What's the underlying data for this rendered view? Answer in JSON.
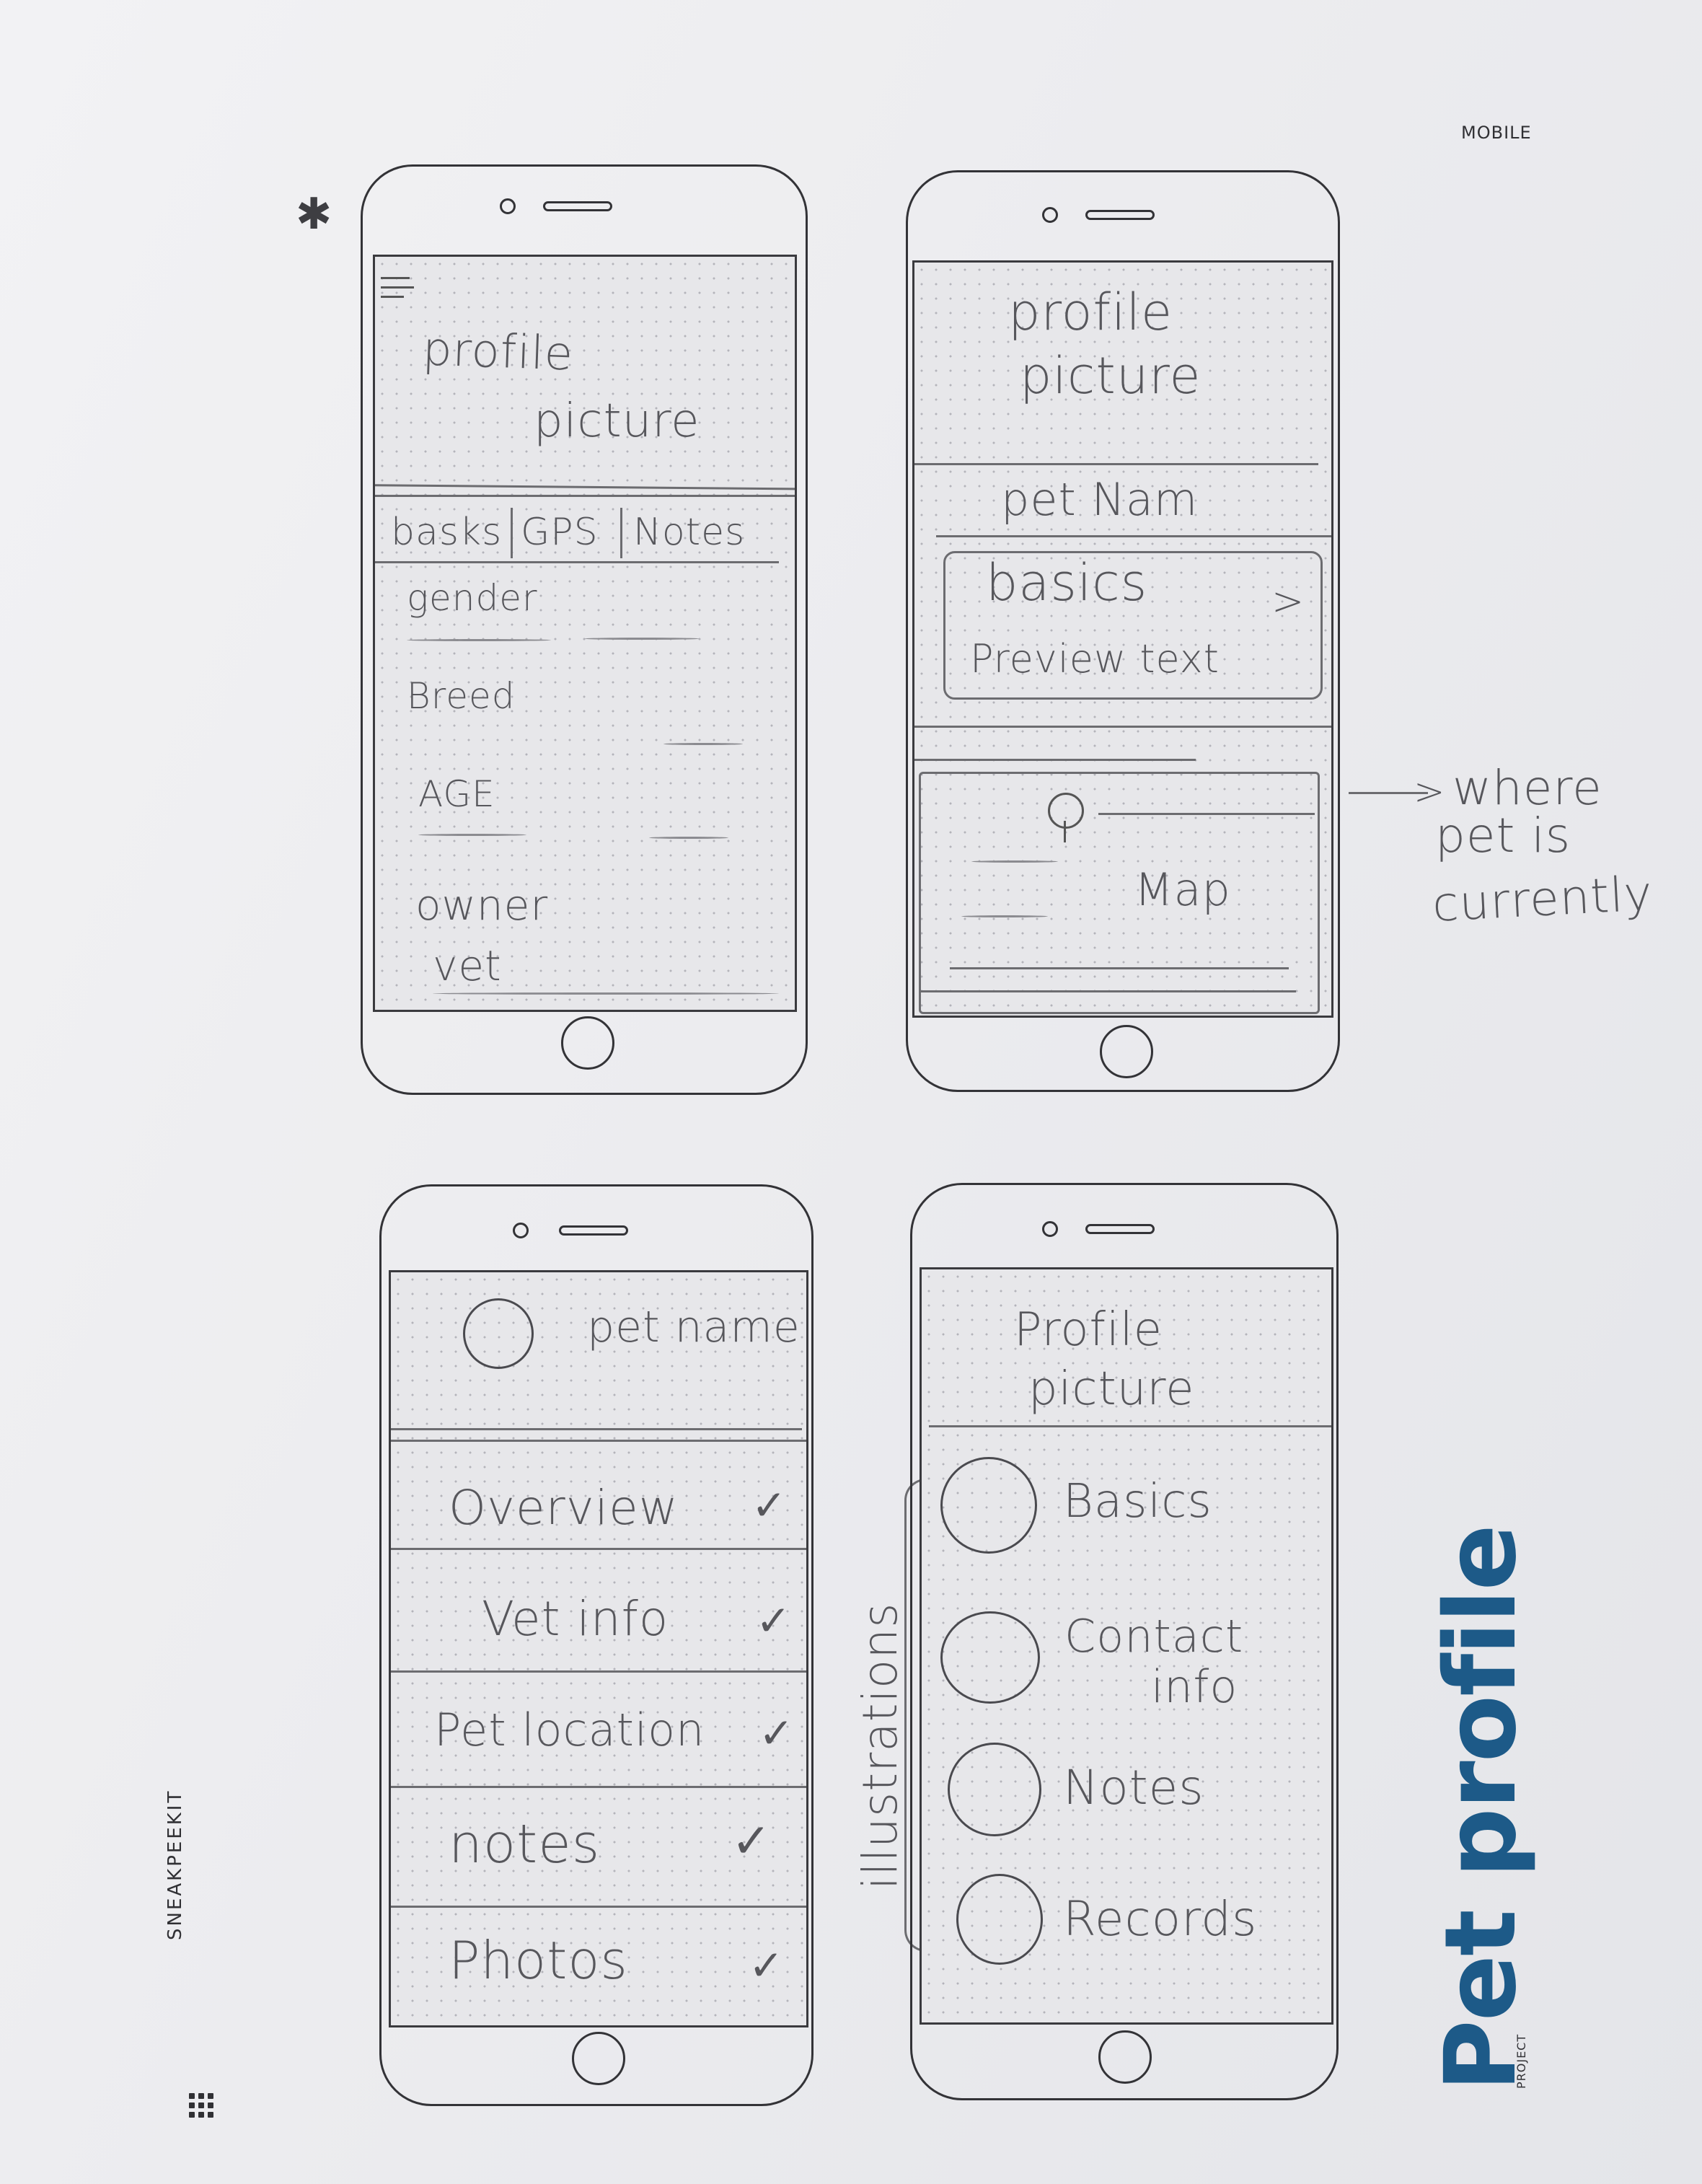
{
  "sheet": {
    "label": "MOBILE",
    "brand": "SNEAKPEEKIT",
    "mark": "✱",
    "title": "Pet profile",
    "subtitle": "PROJECT",
    "title_color": "#1d5a88"
  },
  "wireframe1": {
    "menu_icon": "hamburger-icon",
    "profile_line1": "profile",
    "profile_line2": "picture",
    "tabs": [
      "basks",
      "GPS",
      "Notes"
    ],
    "fields": [
      "gender",
      "Breed",
      "AGE",
      "owner",
      "vet"
    ]
  },
  "wireframe2": {
    "profile_line1": "profile",
    "profile_line2": "picture",
    "pet_name": "pet Nam",
    "card_title": "basics",
    "card_chevron": ">",
    "card_preview": "Preview text",
    "map_icon": "location-pin-icon",
    "map_label": "Map",
    "annotation": [
      "where",
      "pet is",
      "currently"
    ]
  },
  "wireframe3": {
    "avatar_icon": "avatar-circle-icon",
    "pet_name": "pet name",
    "rows": [
      {
        "label": "Overview",
        "check": "✓"
      },
      {
        "label": "Vet info",
        "check": "✓"
      },
      {
        "label": "Pet location",
        "check": "✓"
      },
      {
        "label": "notes",
        "check": "✓"
      },
      {
        "label": "Photos",
        "check": "✓"
      }
    ]
  },
  "wireframe4": {
    "profile_line1": "Profile",
    "profile_line2": "picture",
    "side_note": "illustrations",
    "items": [
      {
        "label": "Basics",
        "icon": "illustration-circle-icon"
      },
      {
        "label": "Contact",
        "label2": "info",
        "icon": "illustration-circle-icon"
      },
      {
        "label": "Notes",
        "icon": "illustration-circle-icon"
      },
      {
        "label": "Records",
        "icon": "illustration-circle-icon"
      }
    ]
  }
}
